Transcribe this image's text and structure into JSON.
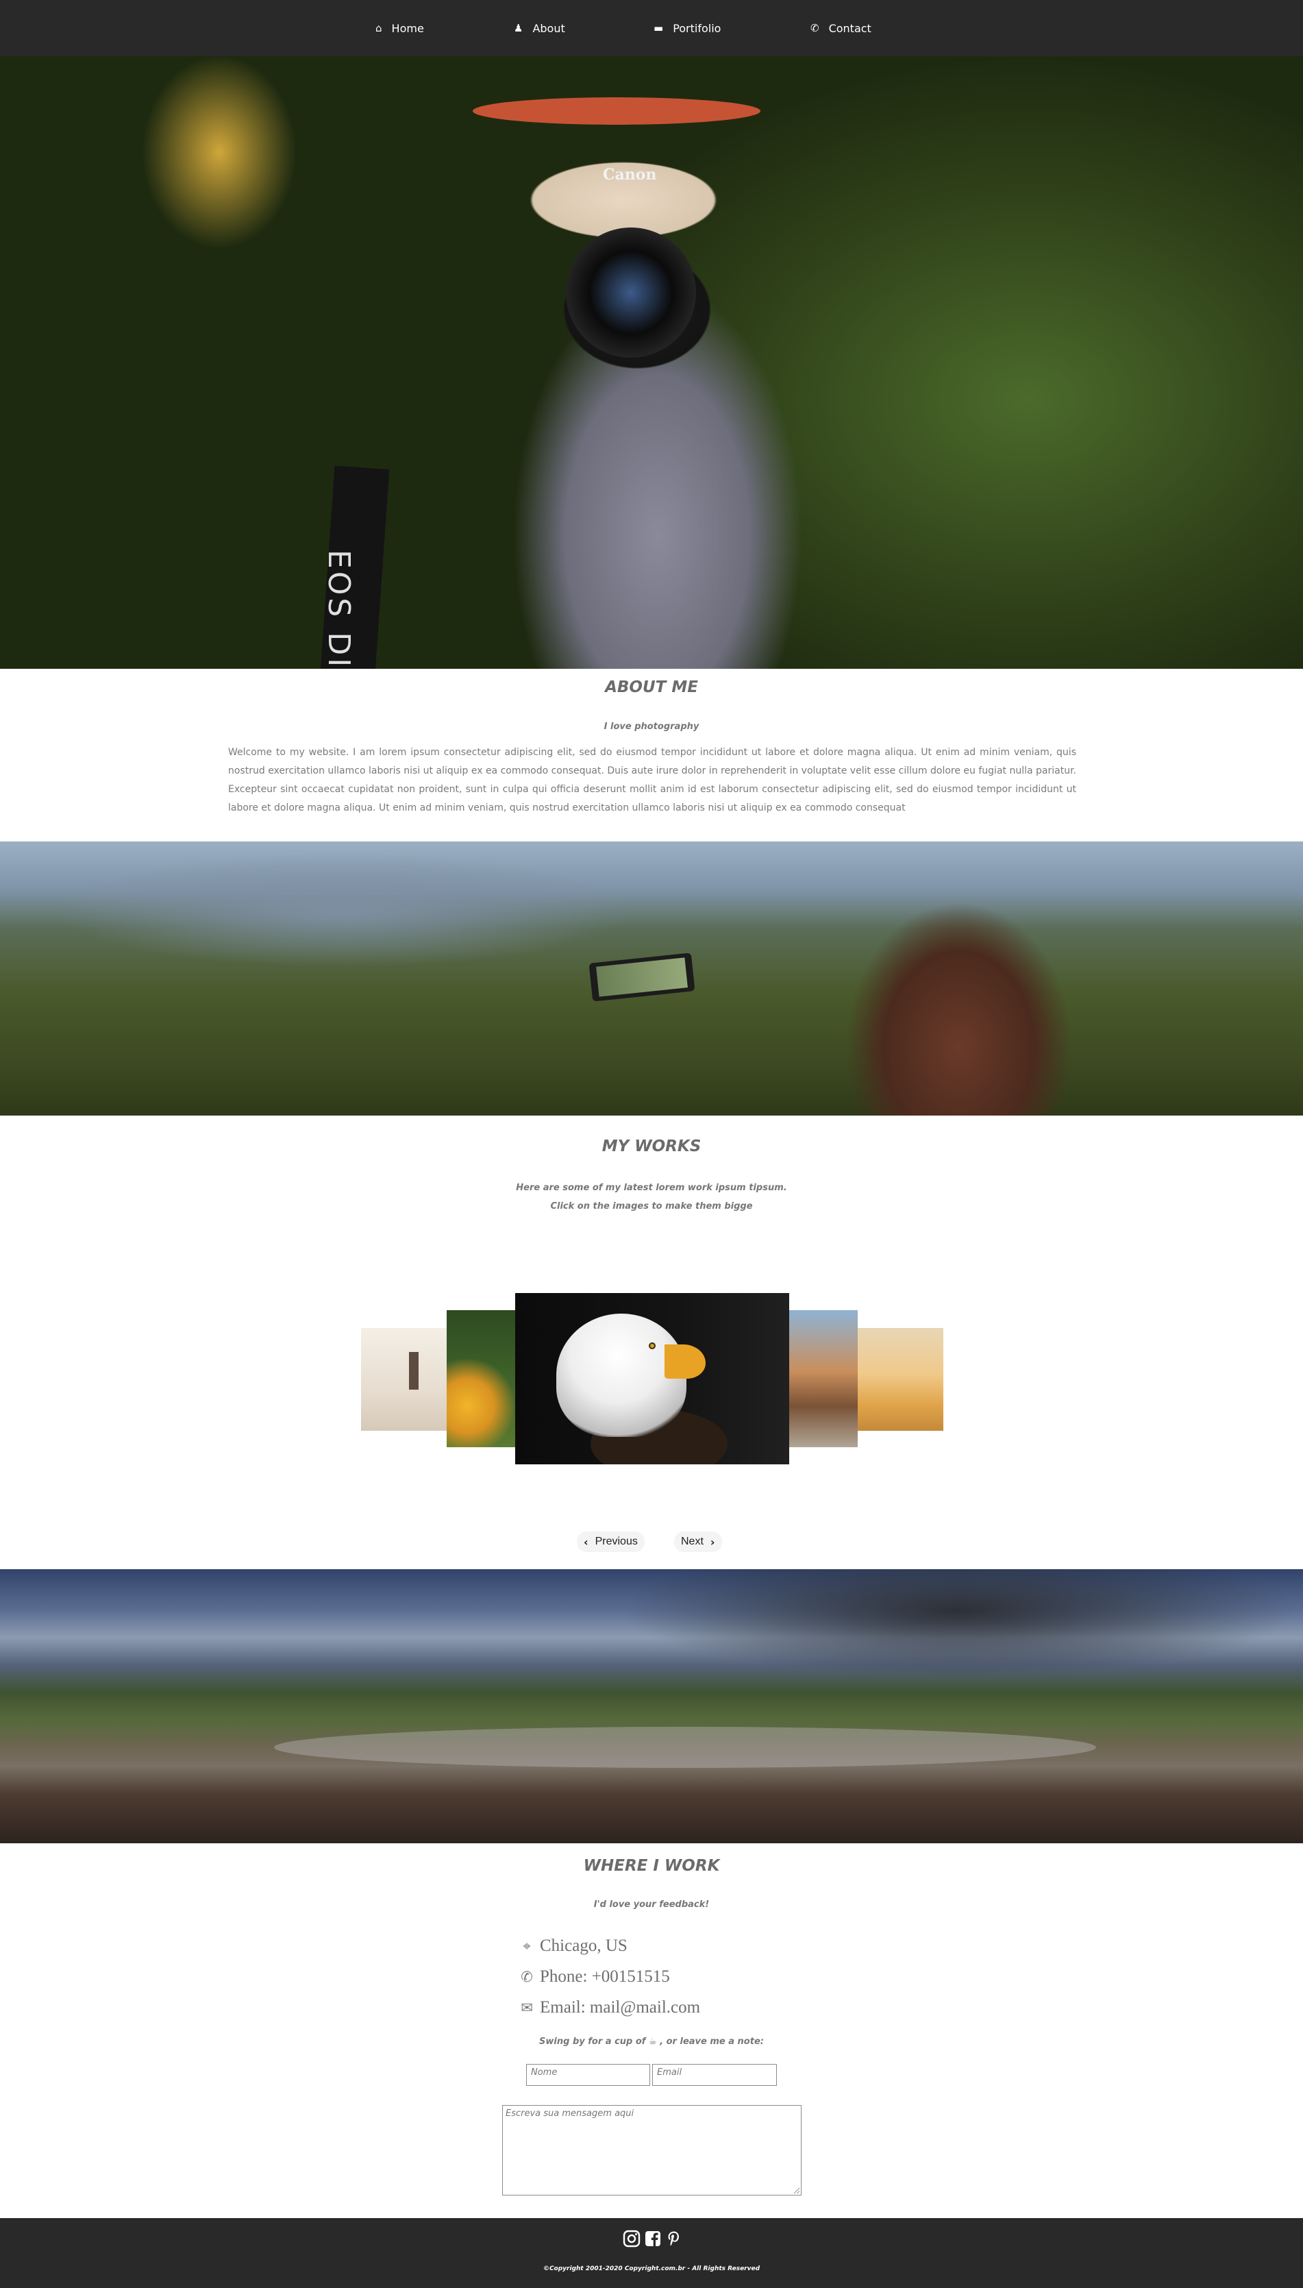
{
  "nav": {
    "items": [
      {
        "label": "Home",
        "icon": "home-icon"
      },
      {
        "label": "About",
        "icon": "user-icon"
      },
      {
        "label": "Portifolio",
        "icon": "folder-icon"
      },
      {
        "label": "Contact",
        "icon": "phone-icon"
      }
    ],
    "background": "#292929"
  },
  "hero": {
    "camera_brand": "Canon",
    "strap_text": "EOS DIGITAL"
  },
  "about": {
    "title": "ABOUT ME",
    "subtitle": "I love photography",
    "body": "Welcome to my website. I am lorem ipsum consectetur adipiscing elit, sed do eiusmod tempor incididunt ut labore et dolore magna aliqua. Ut enim ad minim veniam, quis nostrud exercitation ullamco laboris nisi ut aliquip ex ea commodo consequat. Duis aute irure dolor in reprehenderit in voluptate velit esse cillum dolore eu fugiat nulla pariatur. Excepteur sint occaecat cupidatat non proident, sunt in culpa qui officia deserunt mollit anim id est laborum consectetur adipiscing elit, sed do eiusmod tempor incididunt ut labore et dolore magna aliqua. Ut enim ad minim veniam, quis nostrud exercitation ullamco laboris nisi ut aliquip ex ea commodo consequat"
  },
  "works": {
    "title": "MY WORKS",
    "subtitle_line1": "Here are some of my latest lorem work ipsum tipsum.",
    "subtitle_line2": "Click on the images to make them bigge",
    "slides": [
      "winter-walker-photo",
      "sunflower-photo",
      "bald-eagle-photo",
      "tree-jump-photo",
      "field-cheer-photo"
    ],
    "prev_label": "Previous",
    "next_label": "Next"
  },
  "contact": {
    "title": "WHERE I WORK",
    "subtitle": "I'd love your feedback!",
    "location": "Chicago, US",
    "phone": "Phone: +00151515",
    "email": "Email: mail@mail.com",
    "note": "Swing by for a cup of ☕ , or leave me a note:",
    "name_placeholder": "Nome",
    "email_placeholder": "Email",
    "message_placeholder": "Escreva sua mensagem aqui"
  },
  "footer": {
    "social": [
      "instagram-icon",
      "facebook-icon",
      "pinterest-icon"
    ],
    "copyright": "©Copyright 2001-2020 Copyright.com.br - All Rights Reserved"
  }
}
